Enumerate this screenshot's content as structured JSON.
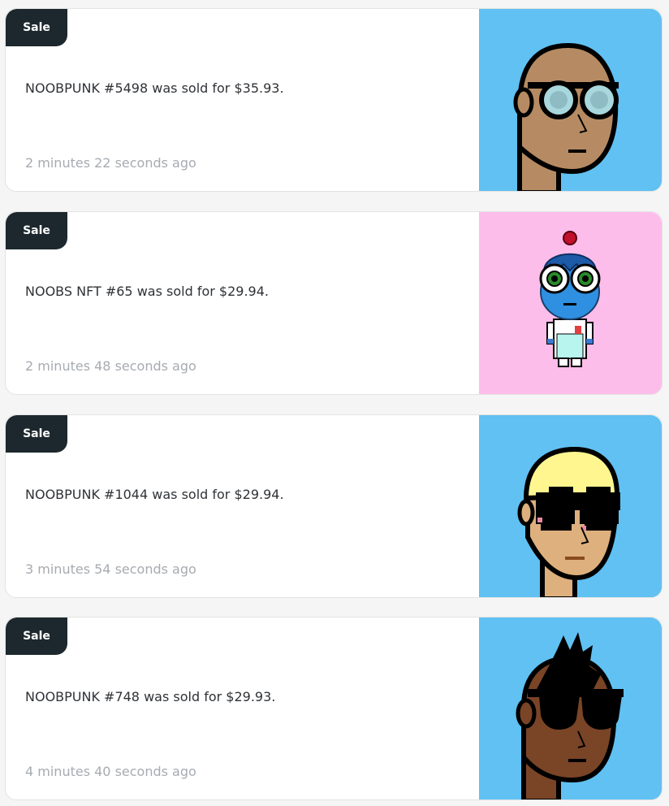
{
  "sales": [
    {
      "badge": "Sale",
      "message": "NOOBPUNK #5498 was sold for $35.93.",
      "time": "2 minutes 22 seconds ago",
      "image": "noobpunk-avatar-glasses",
      "bg": "#60c1f2"
    },
    {
      "badge": "Sale",
      "message": "NOOBS NFT #65 was sold for $29.94.",
      "time": "2 minutes 48 seconds ago",
      "image": "noobs-nft-character",
      "bg": "#fdbdeb"
    },
    {
      "badge": "Sale",
      "message": "NOOBPUNK #1044 was sold for $29.94.",
      "time": "3 minutes 54 seconds ago",
      "image": "noobpunk-avatar-blond-sunglasses",
      "bg": "#60c1f2"
    },
    {
      "badge": "Sale",
      "message": "NOOBPUNK #748 was sold for $29.93.",
      "time": "4 minutes 40 seconds ago",
      "image": "noobpunk-avatar-mohawk-sunglasses",
      "bg": "#60c1f2"
    }
  ]
}
